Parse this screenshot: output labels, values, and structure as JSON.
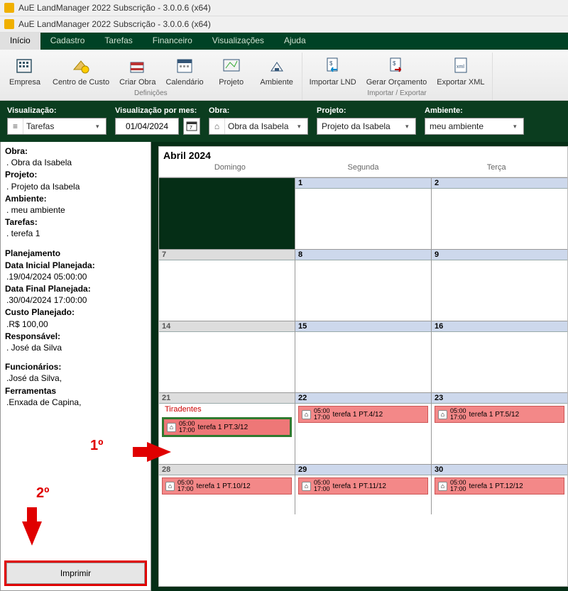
{
  "title1": "AuE LandManager 2022 Subscrição - 3.0.0.6 (x64)",
  "title2": "AuE LandManager 2022 Subscrição - 3.0.0.6 (x64)",
  "menu": {
    "inicio": "Início",
    "cadastro": "Cadastro",
    "tarefas": "Tarefas",
    "financeiro": "Financeiro",
    "visualizacoes": "Visualizações",
    "ajuda": "Ajuda"
  },
  "ribbon": {
    "definicoes": {
      "caption": "Definições",
      "empresa": "Empresa",
      "centro": "Centro de Custo",
      "criar": "Criar Obra",
      "calendario": "Calendário",
      "projeto": "Projeto",
      "ambiente": "Ambiente"
    },
    "importexport": {
      "caption": "Importar / Exportar",
      "importar": "Importar LND",
      "gerar": "Gerar Orçamento",
      "exportar": "Exportar XML"
    }
  },
  "filter": {
    "visualizacao_label": "Visualização:",
    "visualizacao_value": "Tarefas",
    "vis_mes_label": "Visualização por mes:",
    "vis_mes_value": "01/04/2024",
    "obra_label": "Obra:",
    "obra_value": "Obra da Isabela",
    "projeto_label": "Projeto:",
    "projeto_value": "Projeto da Isabela",
    "ambiente_label": "Ambiente:",
    "ambiente_value": "meu ambiente"
  },
  "side": {
    "obra_h": "Obra:",
    "obra_v": ". Obra da Isabela",
    "projeto_h": "Projeto:",
    "projeto_v": ". Projeto da Isabela",
    "ambiente_h": "Ambiente:",
    "ambiente_v": ". meu ambiente",
    "tarefas_h": "Tarefas:",
    "tarefas_v": ". terefa 1",
    "plan_h": "Planejamento",
    "dip_h": "Data Inicial Planejada:",
    "dip_v": ".19/04/2024 05:00:00",
    "dfp_h": "Data Final Planejada:",
    "dfp_v": ".30/04/2024 17:00:00",
    "custo_h": "Custo Planejado:",
    "custo_v": ".R$ 100,00",
    "resp_h": "Responsável:",
    "resp_v": ". José da Silva",
    "func_h": "Funcionários:",
    "func_v": ".José da Silva,",
    "ferr_h": "Ferramentas",
    "ferr_v": ".Enxada de Capina,",
    "imprimir": "Imprimir"
  },
  "cal": {
    "month": "Abril 2024",
    "heads": [
      "Domingo",
      "Segunda",
      "Terça"
    ],
    "wk1": [
      "",
      "1",
      "2"
    ],
    "wk2": [
      "7",
      "8",
      "9"
    ],
    "wk3": [
      "14",
      "15",
      "16"
    ],
    "wk4": [
      "21",
      "22",
      "23"
    ],
    "wk5": [
      "28",
      "29",
      "30"
    ],
    "holiday": "Tiradentes",
    "ev_time1": "05:00",
    "ev_time2": "17:00",
    "ev_3": "terefa 1 PT.3/12",
    "ev_4": "terefa 1 PT.4/12",
    "ev_5": "terefa 1 PT.5/12",
    "ev_10": "terefa 1 PT.10/12",
    "ev_11": "terefa 1 PT.11/12",
    "ev_12": "terefa 1 PT.12/12"
  },
  "annot": {
    "n1": "1º",
    "n2": "2º"
  }
}
